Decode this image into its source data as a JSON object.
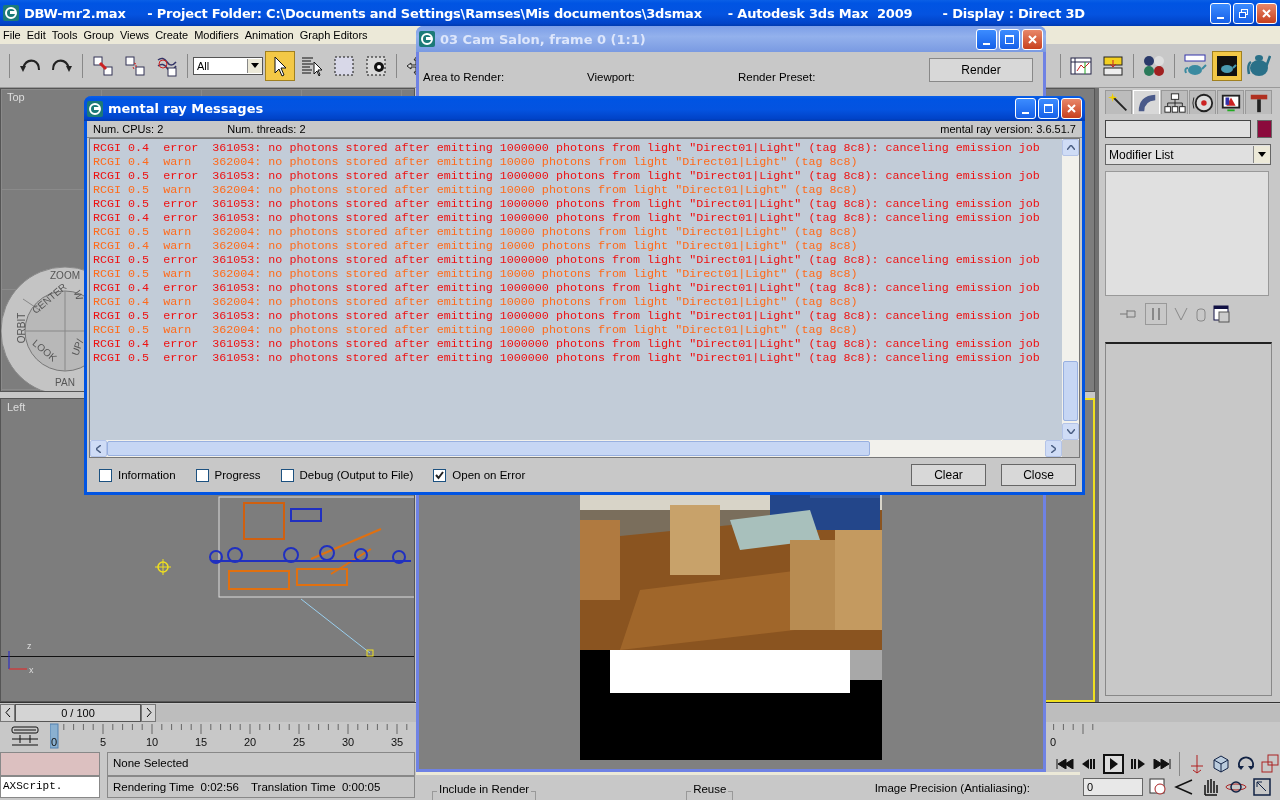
{
  "app_window": {
    "title": "DBW-mr2.max     - Project Folder: C:\\Documents and Settings\\Ramses\\Mis documentos\\3dsmax      - Autodesk 3ds Max  2009       - Display : Direct 3D"
  },
  "menu": [
    "File",
    "Edit",
    "Tools",
    "Group",
    "Views",
    "Create",
    "Modifiers",
    "Animation",
    "Graph Editors"
  ],
  "main_toolbar": {
    "selection_filter": "All",
    "tools": [
      {
        "selected": false
      },
      {
        "selected": false
      },
      {
        "selected": false
      },
      {
        "selected": false
      },
      {
        "selected": false
      },
      {
        "selected": true
      },
      {
        "selected": false
      },
      {
        "selected": false
      },
      {
        "selected": false
      },
      {
        "selected": false
      },
      {
        "selected": false
      },
      {
        "selected": false
      },
      {
        "selected": false
      },
      {
        "selected": false
      },
      {
        "selected": true
      },
      {
        "selected": false
      }
    ]
  },
  "viewports": [
    {
      "label": "Top"
    },
    {
      "label": "Left"
    }
  ],
  "nav_wheel": {
    "labels": [
      "ZOOM",
      "CENTER",
      "W",
      "ORBIT",
      "LOOK",
      "UP/",
      "PAN"
    ]
  },
  "left_axes": [
    "z",
    "x"
  ],
  "command_panel": {
    "tabs": [
      {
        "selected": false
      },
      {
        "selected": true
      },
      {
        "selected": false
      },
      {
        "selected": false
      },
      {
        "selected": false
      },
      {
        "selected": false
      }
    ],
    "modifier_list": "Modifier List"
  },
  "time_slider": {
    "frame": "0 / 100"
  },
  "track_bar": {
    "ticks": [
      "0",
      "5",
      "10",
      "15",
      "20",
      "25",
      "30",
      "35"
    ],
    "end_fragment": "0"
  },
  "status": {
    "script_field": "AXScript.",
    "selection": "None Selected",
    "rendering_time": "Rendering Time  0:02:56",
    "translation_time": "Translation Time  0:00:05",
    "frame_field": "0"
  },
  "render_window": {
    "title": "03 Cam Salon, frame 0 (1:1)",
    "fields": [
      "Area to Render:",
      "Viewport:",
      "Render Preset:"
    ],
    "render_button": "Render",
    "groups": [
      "Include in Render",
      "Reuse"
    ],
    "precision_label": "Image Precision (Antialiasing):"
  },
  "messages_window": {
    "title": "mental ray Messages",
    "cpus": "Num. CPUs: 2",
    "threads": "Num. threads: 2",
    "version": "mental ray version: 3.6.51.7",
    "lines": [
      {
        "kind": "error",
        "text": "RCGI 0.4  error  361053: no photons stored after emitting 1000000 photons from light \"Direct01|Light\" (tag 8c8): canceling emission job"
      },
      {
        "kind": "warn",
        "text": "RCGI 0.4  warn   362004: no photons stored after emitting 10000 photons from light \"Direct01|Light\" (tag 8c8)"
      },
      {
        "kind": "error",
        "text": "RCGI 0.5  error  361053: no photons stored after emitting 1000000 photons from light \"Direct01|Light\" (tag 8c8): canceling emission job"
      },
      {
        "kind": "warn",
        "text": "RCGI 0.5  warn   362004: no photons stored after emitting 10000 photons from light \"Direct01|Light\" (tag 8c8)"
      },
      {
        "kind": "error",
        "text": "RCGI 0.5  error  361053: no photons stored after emitting 1000000 photons from light \"Direct01|Light\" (tag 8c8): canceling emission job"
      },
      {
        "kind": "error",
        "text": "RCGI 0.4  error  361053: no photons stored after emitting 1000000 photons from light \"Direct01|Light\" (tag 8c8): canceling emission job"
      },
      {
        "kind": "warn",
        "text": "RCGI 0.5  warn   362004: no photons stored after emitting 10000 photons from light \"Direct01|Light\" (tag 8c8)"
      },
      {
        "kind": "warn",
        "text": "RCGI 0.4  warn   362004: no photons stored after emitting 10000 photons from light \"Direct01|Light\" (tag 8c8)"
      },
      {
        "kind": "error",
        "text": "RCGI 0.5  error  361053: no photons stored after emitting 1000000 photons from light \"Direct01|Light\" (tag 8c8): canceling emission job"
      },
      {
        "kind": "warn",
        "text": "RCGI 0.5  warn   362004: no photons stored after emitting 10000 photons from light \"Direct01|Light\" (tag 8c8)"
      },
      {
        "kind": "error",
        "text": "RCGI 0.4  error  361053: no photons stored after emitting 1000000 photons from light \"Direct01|Light\" (tag 8c8): canceling emission job"
      },
      {
        "kind": "warn",
        "text": "RCGI 0.4  warn   362004: no photons stored after emitting 10000 photons from light \"Direct01|Light\" (tag 8c8)"
      },
      {
        "kind": "error",
        "text": "RCGI 0.5  error  361053: no photons stored after emitting 1000000 photons from light \"Direct01|Light\" (tag 8c8): canceling emission job"
      },
      {
        "kind": "warn",
        "text": "RCGI 0.5  warn   362004: no photons stored after emitting 10000 photons from light \"Direct01|Light\" (tag 8c8)"
      },
      {
        "kind": "error",
        "text": "RCGI 0.4  error  361053: no photons stored after emitting 1000000 photons from light \"Direct01|Light\" (tag 8c8): canceling emission job"
      },
      {
        "kind": "error",
        "text": "RCGI 0.5  error  361053: no photons stored after emitting 1000000 photons from light \"Direct01|Light\" (tag 8c8): canceling emission job"
      }
    ],
    "options": [
      {
        "label": "Information",
        "checked": false
      },
      {
        "label": "Progress",
        "checked": false
      },
      {
        "label": "Debug (Output to File)",
        "checked": false
      },
      {
        "label": "Open on Error",
        "checked": true
      }
    ],
    "buttons": [
      "Clear",
      "Close"
    ]
  }
}
